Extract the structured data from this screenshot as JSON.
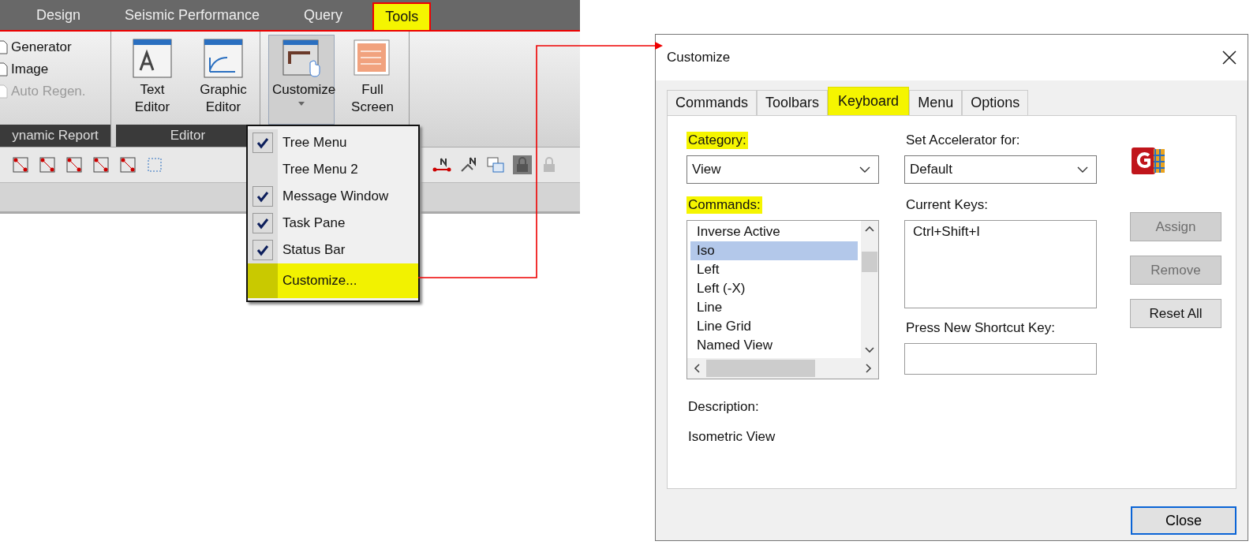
{
  "ribbon": {
    "tabs": [
      {
        "label": "Design",
        "selected": false
      },
      {
        "label": "Seismic Performance",
        "selected": false
      },
      {
        "label": "Query",
        "selected": false
      },
      {
        "label": "Tools",
        "selected": true
      }
    ],
    "groups": [
      {
        "kind": "list",
        "label": "ynamic Report",
        "items": [
          {
            "label": "Generator",
            "disabled": false
          },
          {
            "label": "Image",
            "disabled": false
          },
          {
            "label": "Auto Regen.",
            "disabled": true
          }
        ]
      },
      {
        "kind": "large",
        "label": "Editor",
        "buttons": [
          {
            "label": "Text Editor",
            "pressed": false,
            "dropdown": false
          },
          {
            "label": "Graphic Editor",
            "pressed": false,
            "dropdown": false
          }
        ]
      },
      {
        "kind": "large",
        "buttons": [
          {
            "label": "Customize",
            "pressed": true,
            "dropdown": true
          },
          {
            "label": "Full Screen",
            "pressed": false,
            "dropdown": false
          }
        ]
      }
    ]
  },
  "dropdown_menu": {
    "items": [
      {
        "label": "Tree Menu",
        "checked": true,
        "highlighted": false
      },
      {
        "label": "Tree Menu 2",
        "checked": false,
        "highlighted": false
      },
      {
        "label": "Message Window",
        "checked": true,
        "highlighted": false
      },
      {
        "label": "Task Pane",
        "checked": true,
        "highlighted": false
      },
      {
        "label": "Status Bar",
        "checked": true,
        "highlighted": false
      },
      {
        "label": "Customize...",
        "checked": false,
        "highlighted": true
      }
    ]
  },
  "dialog": {
    "title": "Customize",
    "tabs": [
      {
        "label": "Commands",
        "selected": false
      },
      {
        "label": "Toolbars",
        "selected": false
      },
      {
        "label": "Keyboard",
        "selected": true
      },
      {
        "label": "Menu",
        "selected": false
      },
      {
        "label": "Options",
        "selected": false
      }
    ],
    "category": {
      "label": "Category:",
      "highlighted": true,
      "value": "View"
    },
    "accelerator": {
      "label": "Set Accelerator for:",
      "highlighted": false,
      "value": "Default"
    },
    "commands": {
      "label": "Commands:",
      "highlighted": true,
      "items": [
        {
          "label": "Inverse Active",
          "selected": false
        },
        {
          "label": "Iso",
          "selected": true
        },
        {
          "label": "Left",
          "selected": false
        },
        {
          "label": "Left (-X)",
          "selected": false
        },
        {
          "label": "Line",
          "selected": false
        },
        {
          "label": "Line Grid",
          "selected": false
        },
        {
          "label": "Named View",
          "selected": false
        }
      ]
    },
    "current_keys": {
      "label": "Current Keys:",
      "highlighted": false,
      "items": [
        "Ctrl+Shift+I"
      ]
    },
    "new_shortcut": {
      "label": "Press New Shortcut Key:",
      "highlighted": false
    },
    "buttons": [
      {
        "label": "Assign",
        "disabled": true
      },
      {
        "label": "Remove",
        "disabled": true
      },
      {
        "label": "Reset All",
        "disabled": false
      }
    ],
    "description_label": "Description:",
    "description": "Isometric View",
    "close_button": "Close"
  }
}
